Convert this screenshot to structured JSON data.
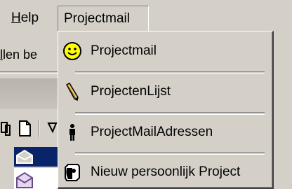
{
  "menubar": {
    "help": {
      "mnemonic": "H",
      "rest": "elp"
    },
    "projectmail": "Projectmail"
  },
  "background": {
    "partial_text_mnemonic": "l",
    "partial_text_rest": "len be"
  },
  "dropdown": {
    "items": [
      {
        "label": "Projectmail",
        "icon": "smiley-icon"
      },
      {
        "label": "ProjectenLijst",
        "icon": "pencil-icon"
      },
      {
        "label": "ProjectMailAdressen",
        "icon": "person-icon"
      },
      {
        "label": "Nieuw persoonlijk Project",
        "icon": "new-project-icon"
      }
    ]
  },
  "colors": {
    "menu_bg": "#d4d0c8",
    "selection": "#0a246a",
    "smiley": "#ffff00"
  }
}
